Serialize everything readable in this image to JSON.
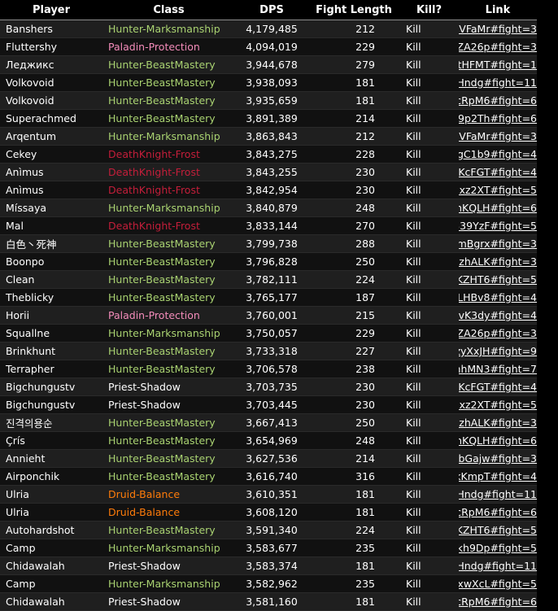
{
  "headers": [
    "Player",
    "Class",
    "DPS",
    "Fight Length",
    "Kill?",
    "Link"
  ],
  "class_colors": {
    "Hunter": "#a9d271",
    "Paladin": "#f48cba",
    "DeathKnight": "#c41e3a",
    "Druid": "#ff7c0a",
    "Priest": "#ffffff"
  },
  "rows": [
    {
      "player": "Banshers",
      "class": "Hunter-Marksmanship",
      "class_color": "#a9d271",
      "dps": "4,179,485",
      "length": "212",
      "kill": "Kill",
      "link": "zVFaMr#fight=3"
    },
    {
      "player": "Fluttershy",
      "class": "Paladin-Protection",
      "class_color": "#f48cba",
      "dps": "4,094,019",
      "length": "229",
      "kill": "Kill",
      "link": ":ZA26p#fight=3"
    },
    {
      "player": "Леджикс",
      "class": "Hunter-BeastMastery",
      "class_color": "#a9d271",
      "dps": "3,944,678",
      "length": "279",
      "kill": "Kill",
      "link": "CtHFMT#fight=1"
    },
    {
      "player": "Volkovoid",
      "class": "Hunter-BeastMastery",
      "class_color": "#a9d271",
      "dps": "3,938,093",
      "length": "181",
      "kill": "Kill",
      "link": "!4Hndg#fight=11"
    },
    {
      "player": "Volkovoid",
      "class": "Hunter-BeastMastery",
      "class_color": "#a9d271",
      "dps": "3,935,659",
      "length": "181",
      "kill": "Kill",
      "link": "'cRpM6#fight=6"
    },
    {
      "player": "Superachmed",
      "class": "Hunter-BeastMastery",
      "class_color": "#a9d271",
      "dps": "3,891,389",
      "length": "214",
      "kill": "Kill",
      "link": "39p2Th#fight=6"
    },
    {
      "player": "Arqentum",
      "class": "Hunter-Marksmanship",
      "class_color": "#a9d271",
      "dps": "3,863,843",
      "length": "212",
      "kill": "Kill",
      "link": "zVFaMr#fight=3"
    },
    {
      "player": "Cekey",
      "class": "DeathKnight-Frost",
      "class_color": "#c41e3a",
      "dps": "3,843,275",
      "length": "228",
      "kill": "Kill",
      "link": "PgC1b9#fight=4"
    },
    {
      "player": "Anìmus",
      "class": "DeathKnight-Frost",
      "class_color": "#c41e3a",
      "dps": "3,843,255",
      "length": "230",
      "kill": "Kill",
      "link": ")KcFGT#fight=4"
    },
    {
      "player": "Anìmus",
      "class": "DeathKnight-Frost",
      "class_color": "#c41e3a",
      "dps": "3,842,954",
      "length": "230",
      "kill": "Kill",
      "link": "Rxz2XT#fight=5"
    },
    {
      "player": "Míssaya",
      "class": "Hunter-Marksmanship",
      "class_color": "#a9d271",
      "dps": "3,840,879",
      "length": "248",
      "kill": "Kill",
      "link": "'nKQLH#fight=6"
    },
    {
      "player": "Mal",
      "class": "DeathKnight-Frost",
      "class_color": "#c41e3a",
      "dps": "3,833,144",
      "length": "270",
      "kill": "Kill",
      "link": "339YzF#fight=5"
    },
    {
      "player": "白色丶死神",
      "class": "Hunter-BeastMastery",
      "class_color": "#a9d271",
      "dps": "3,799,738",
      "length": "288",
      "kill": "Kill",
      "link": "TmBgrx#fight=3"
    },
    {
      "player": "Boonpo",
      "class": "Hunter-BeastMastery",
      "class_color": "#a9d271",
      "dps": "3,796,828",
      "length": "250",
      "kill": "Kill",
      "link": "«zhALK#fight=3"
    },
    {
      "player": "Clean",
      "class": "Hunter-BeastMastery",
      "class_color": "#a9d271",
      "dps": "3,782,111",
      "length": "224",
      "kill": "Kill",
      "link": "KZHT6#fight=5"
    },
    {
      "player": "Theblicky",
      "class": "Hunter-BeastMastery",
      "class_color": "#a9d271",
      "dps": "3,765,177",
      "length": "187",
      "kill": "Kill",
      "link": "jLHBv8#fight=4"
    },
    {
      "player": "Horii",
      "class": "Paladin-Protection",
      "class_color": "#f48cba",
      "dps": "3,760,001",
      "length": "215",
      "kill": "Kill",
      "link": "3vK3dy#fight=4"
    },
    {
      "player": "Squallne",
      "class": "Hunter-Marksmanship",
      "class_color": "#a9d271",
      "dps": "3,750,057",
      "length": "229",
      "kill": "Kill",
      "link": ":ZA26p#fight=3"
    },
    {
      "player": "Brinkhunt",
      "class": "Hunter-BeastMastery",
      "class_color": "#a9d271",
      "dps": "3,733,318",
      "length": "227",
      "kill": "Kill",
      "link": "zyXxJH#fight=9"
    },
    {
      "player": "Terrapher",
      "class": "Hunter-BeastMastery",
      "class_color": "#a9d271",
      "dps": "3,706,578",
      "length": "238",
      "kill": "Kill",
      "link": "mhMN3#fight=7"
    },
    {
      "player": "Bigchungustv",
      "class": "Priest-Shadow",
      "class_color": "#ffffff",
      "dps": "3,703,735",
      "length": "230",
      "kill": "Kill",
      "link": ")KcFGT#fight=4"
    },
    {
      "player": "Bigchungustv",
      "class": "Priest-Shadow",
      "class_color": "#ffffff",
      "dps": "3,703,445",
      "length": "230",
      "kill": "Kill",
      "link": "Rxz2XT#fight=5"
    },
    {
      "player": "진격의용순",
      "class": "Hunter-BeastMastery",
      "class_color": "#a9d271",
      "dps": "3,667,413",
      "length": "250",
      "kill": "Kill",
      "link": "«zhALK#fight=3"
    },
    {
      "player": "Çrís",
      "class": "Hunter-BeastMastery",
      "class_color": "#a9d271",
      "dps": "3,654,969",
      "length": "248",
      "kill": "Kill",
      "link": "'nKQLH#fight=6"
    },
    {
      "player": "Annieht",
      "class": "Hunter-BeastMastery",
      "class_color": "#a9d271",
      "dps": "3,627,536",
      "length": "214",
      "kill": "Kill",
      "link": "BbGajw#fight=3"
    },
    {
      "player": "Airponchik",
      "class": "Hunter-BeastMastery",
      "class_color": "#a9d271",
      "dps": "3,616,740",
      "length": "316",
      "kill": "Kill",
      "link": "jkKmpT#fight=4"
    },
    {
      "player": "Ulria",
      "class": "Druid-Balance",
      "class_color": "#ff7c0a",
      "dps": "3,610,351",
      "length": "181",
      "kill": "Kill",
      "link": "!4Hndg#fight=11"
    },
    {
      "player": "Ulria",
      "class": "Druid-Balance",
      "class_color": "#ff7c0a",
      "dps": "3,608,120",
      "length": "181",
      "kill": "Kill",
      "link": "'cRpM6#fight=6"
    },
    {
      "player": "Autohardshot",
      "class": "Hunter-BeastMastery",
      "class_color": "#a9d271",
      "dps": "3,591,340",
      "length": "224",
      "kill": "Kill",
      "link": "KZHT6#fight=5"
    },
    {
      "player": "Camp",
      "class": "Hunter-Marksmanship",
      "class_color": "#a9d271",
      "dps": "3,583,677",
      "length": "235",
      "kill": "Kill",
      "link": "3kh9Dp#fight=5"
    },
    {
      "player": "Chidawalah",
      "class": "Priest-Shadow",
      "class_color": "#ffffff",
      "dps": "3,583,374",
      "length": "181",
      "kill": "Kill",
      "link": "!4Hndg#fight=11"
    },
    {
      "player": "Camp",
      "class": "Hunter-Marksmanship",
      "class_color": "#a9d271",
      "dps": "3,582,962",
      "length": "235",
      "kill": "Kill",
      "link": "YxwXcL#fight=5"
    },
    {
      "player": "Chidawalah",
      "class": "Priest-Shadow",
      "class_color": "#ffffff",
      "dps": "3,581,160",
      "length": "181",
      "kill": "Kill",
      "link": "'cRpM6#fight=6"
    }
  ]
}
